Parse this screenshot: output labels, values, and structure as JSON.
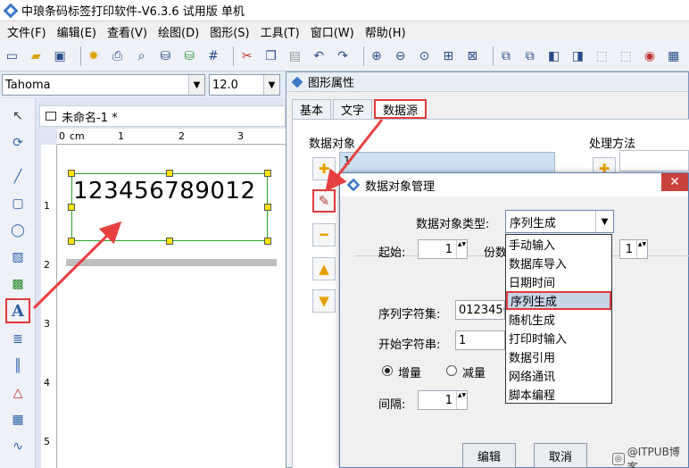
{
  "app": {
    "title": "中琅条码标签打印软件-V6.3.6 试用版 单机"
  },
  "menu": [
    "文件(F)",
    "编辑(E)",
    "查看(V)",
    "绘图(D)",
    "图形(S)",
    "工具(T)",
    "窗口(W)",
    "帮助(H)"
  ],
  "fontbar": {
    "font": "Tahoma",
    "size": "12.0"
  },
  "document": {
    "tab_title": "未命名-1 *",
    "ruler_unit": "cm",
    "ruler_top_ticks": [
      "0",
      "1",
      "2",
      "3"
    ],
    "ruler_left_ticks": [
      "1",
      "2",
      "3",
      "4",
      "5"
    ],
    "barcode_text": "123456789012"
  },
  "props_window": {
    "title": "图形属性",
    "tabs": [
      "基本",
      "文字",
      "数据源"
    ],
    "active_tab": "数据源",
    "data_objects_label": "数据对象",
    "processing_label": "处理方法",
    "data_object_item": "1"
  },
  "dialog": {
    "title": "数据对象管理",
    "type_label": "数据对象类型:",
    "type_value": "序列生成",
    "type_options": [
      "手动输入",
      "数据库导入",
      "日期时间",
      "序列生成",
      "随机生成",
      "打印时输入",
      "数据引用",
      "网络通讯",
      "脚本编程"
    ],
    "start_label": "起始:",
    "start_value": "1",
    "copies_label": "份数",
    "copies_value": "1",
    "charset_label": "序列字符集:",
    "charset_value": "0123456789",
    "start_string_label": "开始字符串:",
    "start_string_value": "1",
    "increment_label": "增量",
    "decrement_label": "减量",
    "interval_label": "间隔:",
    "interval_value": "1",
    "edit_button": "编辑",
    "cancel_button": "取消"
  },
  "watermark": "@ITPUB博客",
  "colors": {
    "highlight_red": "#e23b3b",
    "selection_green": "#2aa52a",
    "handle_yellow": "#ffe400"
  }
}
